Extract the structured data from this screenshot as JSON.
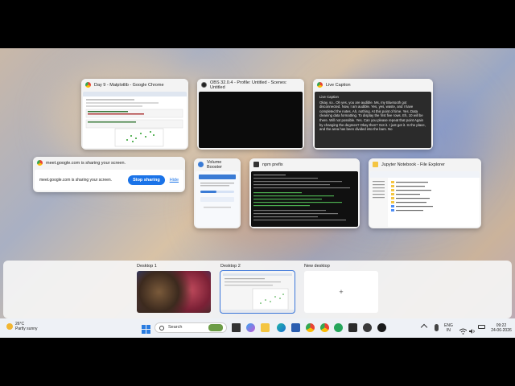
{
  "windows": {
    "chrome": {
      "title": "Day 9 - Matplotlib - Google Chrome"
    },
    "obs": {
      "title": "OBS 32.0.4 - Profile: Untitled - Scenes: Untitled"
    },
    "caption": {
      "title": "Live Caption",
      "heading": "Live Caption",
      "text": "Okay, so.. Oh yes, you are audible. Ms, my Bluetooth got disconnected. Now, I am audible. Yes, yes, waste, and I have completed the notes. Ah, nothing. At this point of time. Yes. Data cleaning data formatting. To display the first five rows. Eh, 10 will be there. Will not possible. Yes. Can you please repeat that point Again by changing the degrees? Okay then? Got it. I just got it. In the place, and the area has been divided into the bars. No"
    },
    "meet": {
      "title": "meet.google.com is sharing your screen.",
      "message": "meet.google.com is sharing your screen.",
      "stop_label": "Stop sharing",
      "hide_label": "Hide"
    },
    "volume": {
      "title": "Volume Booster"
    },
    "npm": {
      "title": "npm prefix"
    },
    "explorer": {
      "title": "Jupyter Notebook - File Explorer"
    }
  },
  "desktops": [
    {
      "label": "Desktop 1"
    },
    {
      "label": "Desktop 2"
    },
    {
      "label": "New desktop",
      "plus": "+"
    }
  ],
  "taskbar": {
    "weather_temp": "26°C",
    "weather_desc": "Partly sunny",
    "search_placeholder": "Search",
    "lang1": "ENG",
    "lang2": "IN",
    "time": "09:22",
    "date": "24-06-2026"
  }
}
